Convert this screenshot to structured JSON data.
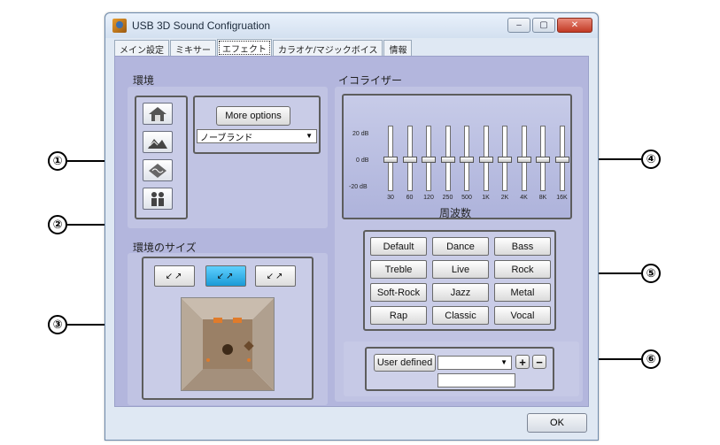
{
  "window": {
    "title": "USB 3D Sound Configruation"
  },
  "window_buttons": {
    "minimize": "–",
    "maximize": "▢",
    "close": "✕"
  },
  "tabs": [
    {
      "label": "メイン設定",
      "active": false
    },
    {
      "label": "ミキサー",
      "active": false
    },
    {
      "label": "エフェクト",
      "active": true
    },
    {
      "label": "カラオケ/マジックボイス",
      "active": false
    },
    {
      "label": "情報",
      "active": false
    }
  ],
  "environment": {
    "label": "環境",
    "more_options": "More options",
    "selected_environment": "ノーブランド",
    "buttons": [
      "env-preset-1",
      "env-preset-2",
      "env-preset-3",
      "env-preset-4"
    ]
  },
  "environment_size": {
    "label": "環境のサイズ",
    "buttons": [
      {
        "label": "↙↗",
        "active": false
      },
      {
        "label": "↙↗",
        "active": true
      },
      {
        "label": "↙↗",
        "active": false
      }
    ]
  },
  "equalizer": {
    "label": "イコライザー",
    "db_labels": [
      "20 dB",
      "0 dB",
      "-20 dB"
    ],
    "frequency_label": "周波数",
    "bands": [
      "30",
      "60",
      "120",
      "250",
      "500",
      "1K",
      "2K",
      "4K",
      "8K",
      "16K"
    ],
    "gains_db": [
      0,
      0,
      0,
      0,
      0,
      0,
      0,
      0,
      0,
      0
    ]
  },
  "presets": [
    "Default",
    "Dance",
    "Bass",
    "Treble",
    "Live",
    "Rock",
    "Soft-Rock",
    "Jazz",
    "Metal",
    "Rap",
    "Classic",
    "Vocal"
  ],
  "user_defined": {
    "button": "User defined",
    "selected": "",
    "add": "+",
    "remove": "−",
    "name_value": ""
  },
  "ok_button": "OK",
  "callouts": [
    "①",
    "②",
    "③",
    "④",
    "⑤",
    "⑥"
  ]
}
